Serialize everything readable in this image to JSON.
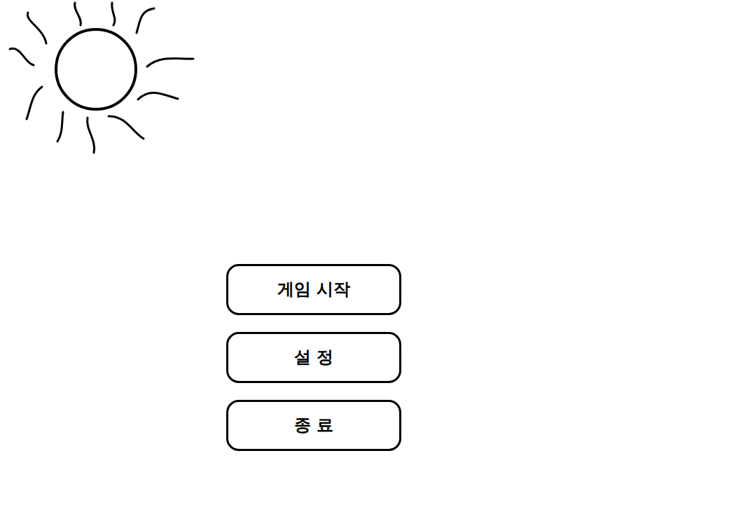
{
  "menu": {
    "buttons": [
      {
        "label": "게임 시작"
      },
      {
        "label": "설 정"
      },
      {
        "label": "종 료"
      }
    ]
  }
}
